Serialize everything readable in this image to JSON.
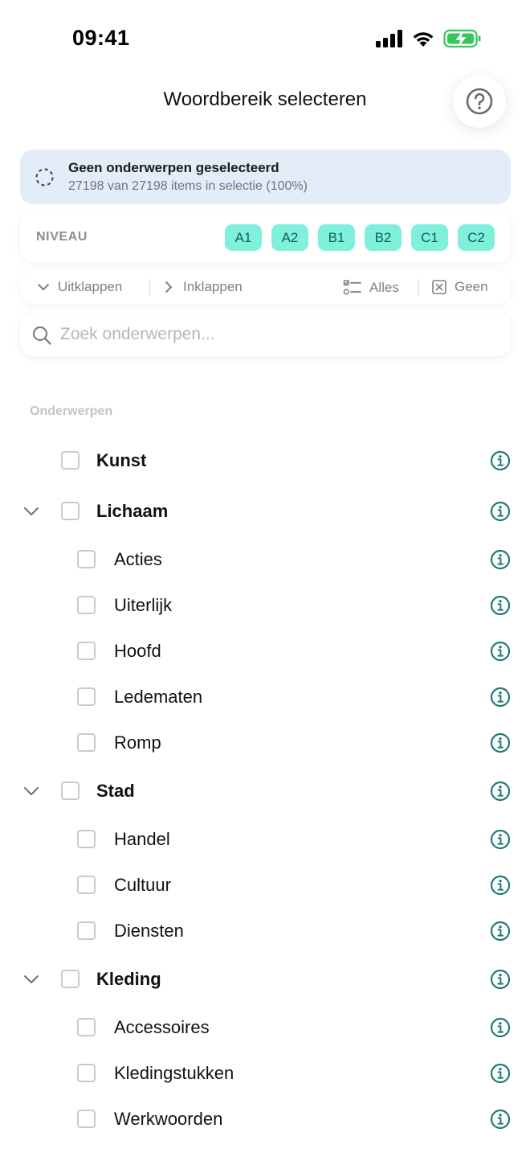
{
  "status_bar": {
    "time": "09:41",
    "icons": [
      "signal-icon",
      "wifi-icon",
      "battery-charging-icon"
    ],
    "battery_color": "#34c759"
  },
  "header": {
    "title": "Woordbereik selecteren",
    "help_icon": "question-circle-icon"
  },
  "selection": {
    "title": "Geen onderwerpen geselecteerd",
    "count": "27198 van 27198 items in selectie (100%)"
  },
  "level": {
    "label": "NIVEAU",
    "chips": [
      "A1",
      "A2",
      "B1",
      "B2",
      "C1",
      "C2"
    ],
    "chip_color": "#7ef0dc"
  },
  "actions": {
    "expand": "Uitklappen",
    "collapse": "Inklappen",
    "all": "Alles",
    "none": "Geen"
  },
  "search": {
    "placeholder": "Zoek onderwerpen...",
    "value": ""
  },
  "section_label": "Onderwerpen",
  "topics": [
    {
      "label": "Kunst",
      "level": 0,
      "expandable": false,
      "checked": false
    },
    {
      "label": "Lichaam",
      "level": 0,
      "expandable": true,
      "expanded": true,
      "checked": false
    },
    {
      "label": "Acties",
      "level": 1,
      "checked": false
    },
    {
      "label": "Uiterlijk",
      "level": 1,
      "checked": false
    },
    {
      "label": "Hoofd",
      "level": 1,
      "checked": false
    },
    {
      "label": "Ledematen",
      "level": 1,
      "checked": false
    },
    {
      "label": "Romp",
      "level": 1,
      "checked": false
    },
    {
      "label": "Stad",
      "level": 0,
      "expandable": true,
      "expanded": true,
      "checked": false
    },
    {
      "label": "Handel",
      "level": 1,
      "checked": false
    },
    {
      "label": "Cultuur",
      "level": 1,
      "checked": false
    },
    {
      "label": "Diensten",
      "level": 1,
      "checked": false
    },
    {
      "label": "Kleding",
      "level": 0,
      "expandable": true,
      "expanded": true,
      "checked": false
    },
    {
      "label": "Accessoires",
      "level": 1,
      "checked": false
    },
    {
      "label": "Kledingstukken",
      "level": 1,
      "checked": false
    },
    {
      "label": "Werkwoorden",
      "level": 1,
      "checked": false
    }
  ],
  "accent_color": "#1f7a74"
}
